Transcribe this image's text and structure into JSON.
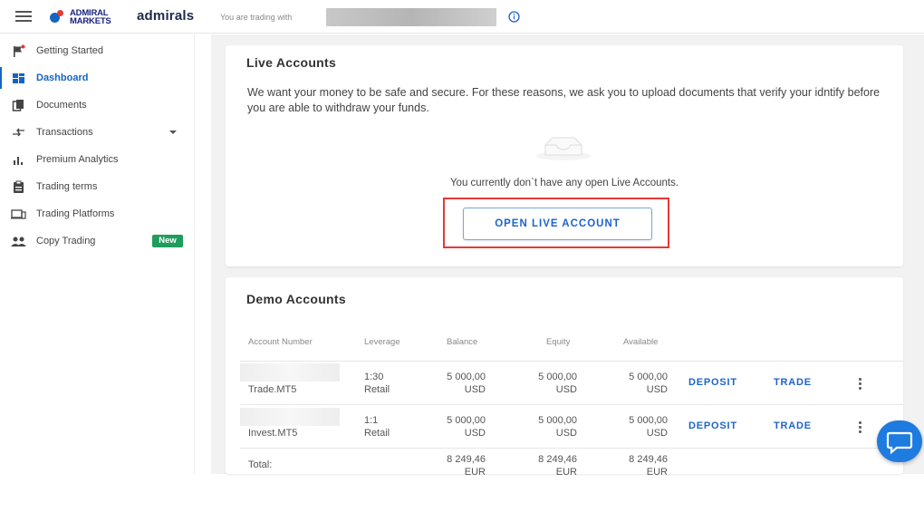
{
  "header": {
    "logo_line1": "ADMIRAL",
    "logo_line2": "MARKETS",
    "brand": "admirals",
    "trading_with": "You are trading with"
  },
  "sidebar": {
    "items": [
      {
        "label": "Getting Started",
        "icon": "flag-icon"
      },
      {
        "label": "Dashboard",
        "icon": "dashboard-icon"
      },
      {
        "label": "Documents",
        "icon": "documents-icon"
      },
      {
        "label": "Transactions",
        "icon": "transfer-icon"
      },
      {
        "label": "Premium Analytics",
        "icon": "bar-chart-icon"
      },
      {
        "label": "Trading terms",
        "icon": "clipboard-icon"
      },
      {
        "label": "Trading Platforms",
        "icon": "laptop-icon"
      },
      {
        "label": "Copy Trading",
        "icon": "people-icon"
      }
    ],
    "new_badge": "New"
  },
  "live": {
    "title": "Live Accounts",
    "description": "We want your money to be safe and secure. For these reasons, we ask you to upload documents that verify your idntify before you are able to withdraw your funds.",
    "empty_text": "You currently don`t have any open Live Accounts.",
    "open_button": "OPEN LIVE ACCOUNT"
  },
  "demo": {
    "title": "Demo Accounts",
    "columns": [
      "Account Number",
      "Leverage",
      "Balance",
      "Equity",
      "Available"
    ],
    "rows": [
      {
        "account": "Trade.MT5",
        "leverage_1": "1:30",
        "leverage_2": "Retail",
        "balance": "5 000,00",
        "balance_cur": "USD",
        "equity": "5 000,00",
        "equity_cur": "USD",
        "available": "5 000,00",
        "available_cur": "USD",
        "deposit": "DEPOSIT",
        "trade": "TRADE"
      },
      {
        "account": "Invest.MT5",
        "leverage_1": "1:1",
        "leverage_2": "Retail",
        "balance": "5 000,00",
        "balance_cur": "USD",
        "equity": "5 000,00",
        "equity_cur": "USD",
        "available": "5 000,00",
        "available_cur": "USD",
        "deposit": "DEPOSIT",
        "trade": "TRADE"
      }
    ],
    "total": {
      "label": "Total:",
      "balance": "8 249,46",
      "balance_cur": "EUR",
      "equity": "8 249,46",
      "equity_cur": "EUR",
      "available": "8 249,46",
      "available_cur": "EUR"
    }
  },
  "colors": {
    "accent": "#1e64c8",
    "new_badge": "#1e9e5a",
    "highlight": "#e53935",
    "chat": "#1e7be0"
  }
}
